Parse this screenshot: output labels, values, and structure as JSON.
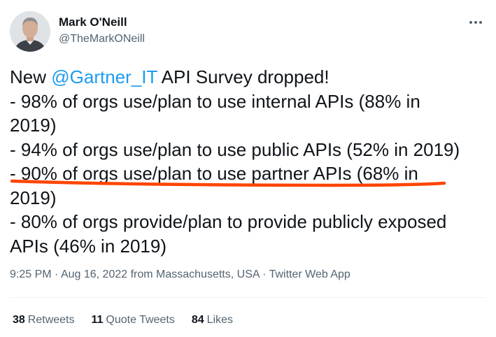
{
  "author": {
    "name": "Mark O'Neill",
    "handle": "@TheMarkONeill"
  },
  "tweet": {
    "intro_before": "New ",
    "mention": "@Gartner_IT",
    "intro_after": " API Survey dropped!",
    "lines": [
      "- 98% of orgs use/plan to use internal APIs (88% in",
      "2019)",
      "- 94% of orgs use/plan to use public APIs (52% in 2019)",
      "- 90% of orgs use/plan to use partner APIs (68% in",
      "2019)",
      "- 80% of orgs provide/plan to provide publicly exposed",
      "APIs (46% in 2019)"
    ],
    "highlight_color": "#ff4500"
  },
  "meta": {
    "time": "9:25 PM",
    "sep1": " · ",
    "date": "Aug 16, 2022",
    "from": " from Massachusetts, USA",
    "sep2": " · ",
    "source": "Twitter Web App"
  },
  "stats": {
    "retweets_count": "38",
    "retweets_label": "Retweets",
    "quotes_count": "11",
    "quotes_label": "Quote Tweets",
    "likes_count": "84",
    "likes_label": "Likes"
  },
  "icons": {
    "more": "more-horizontal-icon"
  },
  "colors": {
    "text": "#0f1419",
    "secondary": "#536471",
    "link": "#1d9bf0"
  }
}
